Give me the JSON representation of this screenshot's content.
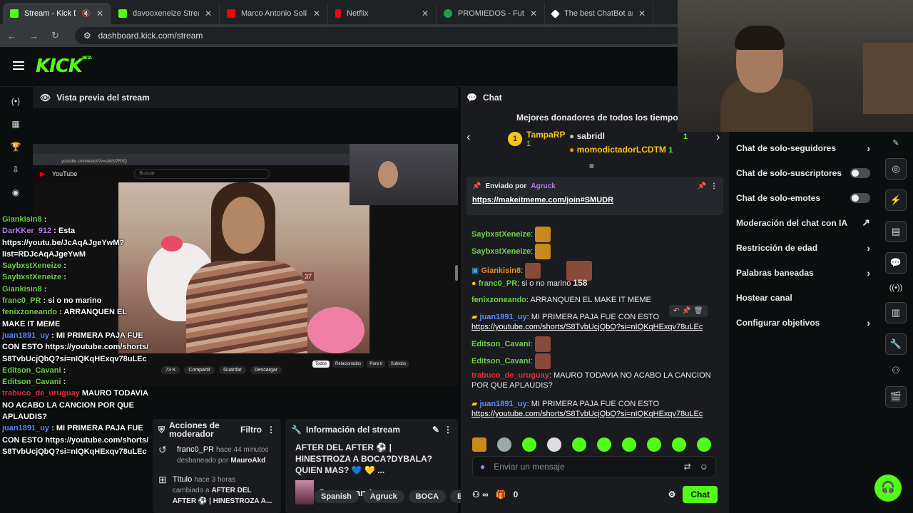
{
  "browser": {
    "tabs": [
      {
        "title": "Stream - Kick Dash",
        "color": "#53fc18",
        "active": true
      },
      {
        "title": "davooxeneize Stream",
        "color": "#53fc18",
        "active": false
      },
      {
        "title": "Marco Antonio Solís -",
        "color": "#ff0000",
        "active": false
      },
      {
        "title": "Netflix",
        "color": "#e50914",
        "active": false
      },
      {
        "title": "PROMIEDOS - Futbol",
        "color": "#20a046",
        "active": false
      },
      {
        "title": "The best ChatBot and",
        "color": "#ffffff",
        "active": false
      }
    ],
    "url": "dashboard.kick.com/stream"
  },
  "logo": {
    "text": "KICK",
    "beta": "BETA"
  },
  "preview": {
    "title": "Vista previa del stream",
    "yt_search_placeholder": "Buscar",
    "yt_url": "youtube.com/watch?v=stkISl7R3Q",
    "yt_actions": [
      "73 K",
      "Compartir",
      "Guardar",
      "Descargar"
    ],
    "yt_tabs": [
      "Todos",
      "Relacionados",
      "Para ti",
      "Subidos"
    ],
    "viewer_count": "37"
  },
  "overlay_chat": [
    {
      "user": "Giankisin8",
      "text": "",
      "color": "#6fd04a"
    },
    {
      "user": "DarKKer_912",
      "text": "Esta https://youtu.be/JcAqAJgeYwM?list=RDJcAqAJgeYwM",
      "color": "#b77cf0"
    },
    {
      "user": "SaybxstXeneize",
      "text": "",
      "color": "#6fd04a"
    },
    {
      "user": "SaybxstXeneize",
      "text": "",
      "color": "#6fd04a"
    },
    {
      "user": "Giankisin8",
      "text": "",
      "color": "#6fd04a"
    },
    {
      "user": "franc0_PR",
      "text": "si o no marino",
      "color": "#6fd04a"
    },
    {
      "user": "fenixzoneando",
      "text": "ARRANQUEN EL MAKE IT MEME",
      "color": "#6fd04a"
    },
    {
      "user": "juan1891_uy",
      "text": "MI PRIMERA PAJA FUE CON ESTO https://youtube.com/shorts/S8TvbUcjQbQ?si=nIQKqHExqv78uLEc",
      "color": "#5b8cff"
    },
    {
      "user": "Editson_Cavani",
      "text": "",
      "color": "#6fd04a"
    },
    {
      "user": "Editson_Cavani",
      "text": "",
      "color": "#6fd04a"
    },
    {
      "user": "trabuco_de_uruguay",
      "text": "MAURO TODAVIA NO ACABO LA CANCION POR QUE APLAUDIS?",
      "color": "#e0313f"
    },
    {
      "user": "juan1891_uy",
      "text": "MI PRIMERA PAJA FUE CON ESTO https://youtube.com/shorts/S8TvbUcjQbQ?si=nIQKqHExqv78uLEc",
      "color": "#5b8cff"
    }
  ],
  "mod_actions": {
    "title": "Acciones de moderador",
    "filter": "Filtro",
    "items": [
      {
        "user": "franc0_PR",
        "time": "hace 44 minutos",
        "action": "desbaneado por",
        "by": "MauroAkd"
      },
      {
        "user": "Título",
        "time": "hace 3 horas",
        "action": "cambiado a",
        "by": "AFTER DEL AFTER ⚽ | HINESTROZA A..."
      }
    ]
  },
  "stream_info": {
    "title": "Información del stream",
    "stream_title": "AFTER DEL AFTER ⚽ | HINESTROZA A BOCA?DYBALA? QUIEN MAS? 💙 💛 ...",
    "category": "Conversando",
    "tags": [
      "Spanish",
      "Agruck",
      "BOCA",
      "BOC"
    ]
  },
  "chat": {
    "title": "Chat",
    "donors_title": "Mejores donadores de todos los tiempos",
    "donors": [
      {
        "name": "TampaRP",
        "amount": "1",
        "rank": "1"
      },
      {
        "name": "sabridl",
        "amount": "1"
      },
      {
        "name": "momodictadorLCDTM",
        "amount": "1"
      }
    ],
    "pinned_by_label": "Enviado por",
    "pinned_by": "Agruck",
    "pinned_link": "https://makeitmeme.com/join#SMUDR",
    "messages": [
      {
        "user": "SaybxstXeneize",
        "text": "",
        "color": "#6fd04a"
      },
      {
        "user": "SaybxstXeneize",
        "text": "",
        "color": "#6fd04a"
      },
      {
        "user": "Giankisin8",
        "text": "",
        "color": "#e88a2a"
      },
      {
        "user": "franc0_PR",
        "text": "si o no marino",
        "color": "#6fd04a"
      },
      {
        "user": "fenixzoneando",
        "text": "ARRANQUEN EL MAKE IT MEME",
        "color": "#6fd04a"
      },
      {
        "user": "juan1891_uy",
        "text": "MI PRIMERA PAJA FUE CON ESTO",
        "link": "https://youtube.com/shorts/S8TvbUcjQbQ?si=nIQKqHExqv78uLEc",
        "color": "#5b8cff"
      },
      {
        "user": "Editson_Cavani",
        "text": "",
        "color": "#6fd04a"
      },
      {
        "user": "Editson_Cavani",
        "text": "",
        "color": "#6fd04a"
      },
      {
        "user": "trabuco_de_uruguay",
        "text": "MAURO TODAVIA NO ACABO LA CANCION POR QUE APLAUDIS?",
        "color": "#e0313f"
      },
      {
        "user": "juan1891_uy",
        "text": "MI PRIMERA PAJA FUE CON ESTO",
        "link": "https://youtube.com/shorts/S8TvbUcjQbQ?si=nIQKqHExqv78uLEc",
        "color": "#5b8cff"
      }
    ],
    "emote_count": "158",
    "input_placeholder": "Enviar un mensaje",
    "points": "0",
    "send_label": "Chat"
  },
  "chat_settings": [
    {
      "label": "Chat de solo-seguidores",
      "control": "arrow"
    },
    {
      "label": "Chat de solo-suscriptores",
      "control": "toggle"
    },
    {
      "label": "Chat de solo-emotes",
      "control": "toggle"
    },
    {
      "label": "Moderación del chat con IA",
      "control": "external"
    },
    {
      "label": "Restricción de edad",
      "control": "arrow"
    },
    {
      "label": "Palabras baneadas",
      "control": "arrow"
    },
    {
      "label": "Hostear canal",
      "control": "none"
    },
    {
      "label": "Configurar objetivos",
      "control": "arrow"
    }
  ],
  "colors": {
    "accent": "#53fc18",
    "bg": "#0b0e0f",
    "panel": "#191b1f"
  }
}
